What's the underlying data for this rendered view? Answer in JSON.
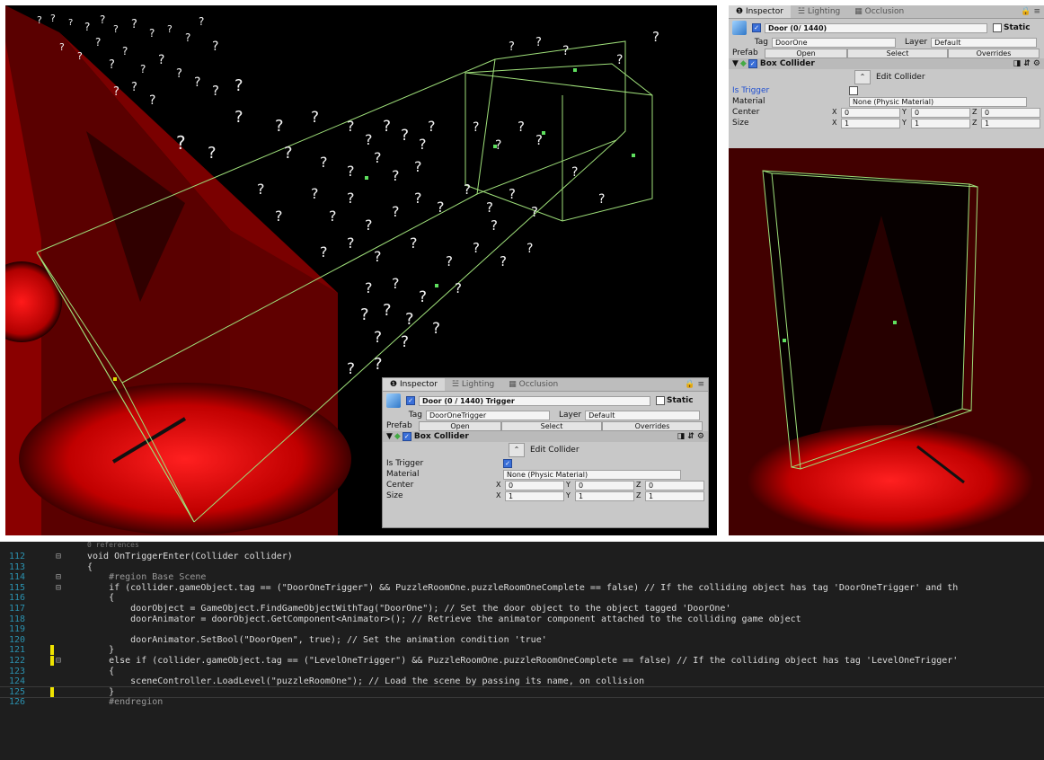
{
  "inspector_top": {
    "tabs": [
      "Inspector",
      "Lighting",
      "Occlusion"
    ],
    "object_name": "Door (0/ 1440)",
    "static_label": "Static",
    "tag_label": "Tag",
    "tag_value": "DoorOne",
    "layer_label": "Layer",
    "layer_value": "Default",
    "prefab_label": "Prefab",
    "prefab_open": "Open",
    "prefab_select": "Select",
    "prefab_overrides": "Overrides",
    "component_title": "Box Collider",
    "edit_collider": "Edit Collider",
    "is_trigger_label": "Is Trigger",
    "is_trigger": false,
    "material_label": "Material",
    "material_value": "None (Physic Material)",
    "center_label": "Center",
    "center": {
      "x": "0",
      "y": "0",
      "z": "0"
    },
    "size_label": "Size",
    "size": {
      "x": "1",
      "y": "1",
      "z": "1"
    }
  },
  "inspector_small": {
    "tabs": [
      "Inspector",
      "Lighting",
      "Occlusion"
    ],
    "object_name": "Door (0 / 1440) Trigger",
    "static_label": "Static",
    "tag_label": "Tag",
    "tag_value": "DoorOneTrigger",
    "layer_label": "Layer",
    "layer_value": "Default",
    "prefab_label": "Prefab",
    "prefab_open": "Open",
    "prefab_select": "Select",
    "prefab_overrides": "Overrides",
    "component_title": "Box Collider",
    "edit_collider": "Edit Collider",
    "is_trigger_label": "Is Trigger",
    "is_trigger": true,
    "material_label": "Material",
    "material_value": "None (Physic Material)",
    "center_label": "Center",
    "center": {
      "x": "0",
      "y": "0",
      "z": "0"
    },
    "size_label": "Size",
    "size": {
      "x": "1",
      "y": "1",
      "z": "1"
    }
  },
  "code": {
    "references_hint": "0 references",
    "lines": [
      {
        "n": "112",
        "text": "void OnTriggerEnter(Collider collider)"
      },
      {
        "n": "113",
        "text": "{"
      },
      {
        "n": "114",
        "text": "    #region Base Scene"
      },
      {
        "n": "115",
        "text": "    if (collider.gameObject.tag == (\"DoorOneTrigger\") && PuzzleRoomOne.puzzleRoomOneComplete == false) // If the colliding object has tag 'DoorOneTrigger' and th"
      },
      {
        "n": "116",
        "text": "    {"
      },
      {
        "n": "117",
        "text": "        doorObject = GameObject.FindGameObjectWithTag(\"DoorOne\"); // Set the door object to the object tagged 'DoorOne'"
      },
      {
        "n": "118",
        "text": "        doorAnimator = doorObject.GetComponent<Animator>(); // Retrieve the animator component attached to the colliding game object"
      },
      {
        "n": "119",
        "text": ""
      },
      {
        "n": "120",
        "text": "        doorAnimator.SetBool(\"DoorOpen\", true); // Set the animation condition 'true'"
      },
      {
        "n": "121",
        "text": "    }"
      },
      {
        "n": "122",
        "text": "    else if (collider.gameObject.tag == (\"LevelOneTrigger\") && PuzzleRoomOne.puzzleRoomOneComplete == false) // If the colliding object has tag 'LevelOneTrigger'"
      },
      {
        "n": "123",
        "text": "    {"
      },
      {
        "n": "124",
        "text": "        sceneController.LoadLevel(\"puzzleRoomOne\"); // Load the scene by passing its name, on collision"
      },
      {
        "n": "125",
        "text": "    }"
      },
      {
        "n": "126",
        "text": "    #endregion"
      }
    ]
  },
  "colors": {
    "scene_red": "#c00000",
    "collider_green": "#9fe07a",
    "code_bg": "#1e1e1e",
    "change_marker": "#efe300"
  }
}
